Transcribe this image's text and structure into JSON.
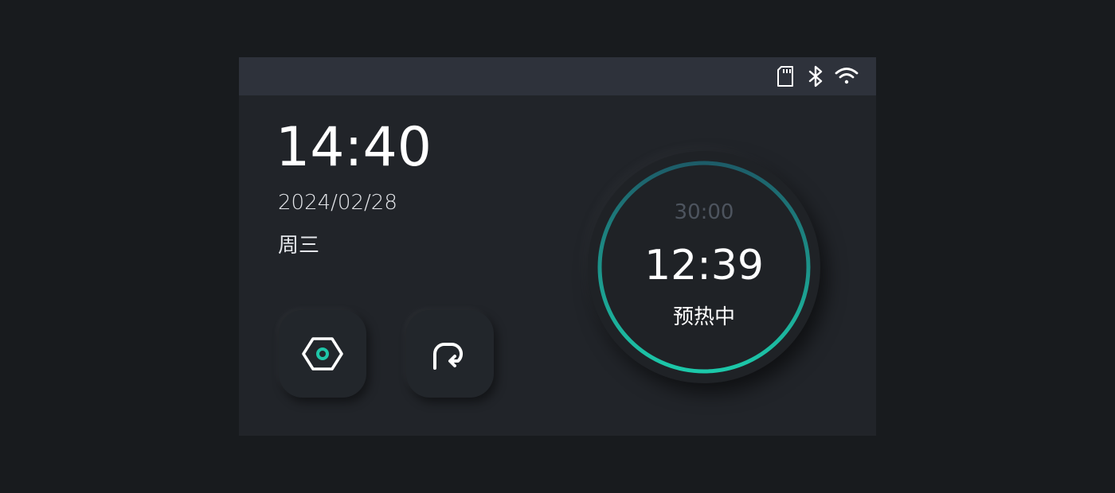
{
  "status_bar": {
    "icons": [
      "sd-card-icon",
      "bluetooth-icon",
      "wifi-icon"
    ]
  },
  "clock": {
    "time": "14:40",
    "date": "2024/02/28",
    "weekday": "周三"
  },
  "buttons": [
    {
      "icon": "settings-hexagon-icon",
      "accent": "#1fc6a8"
    },
    {
      "icon": "rotate-return-icon"
    }
  ],
  "timer": {
    "total": "30:00",
    "remaining": "12:39",
    "status": "预热中",
    "ring_gradient": [
      "#1d5c68",
      "#1cc9aa"
    ]
  },
  "colors": {
    "background": "#181b1e",
    "panel": "#212429",
    "status_bar": "#2e323b",
    "accent": "#1fc6a8"
  }
}
